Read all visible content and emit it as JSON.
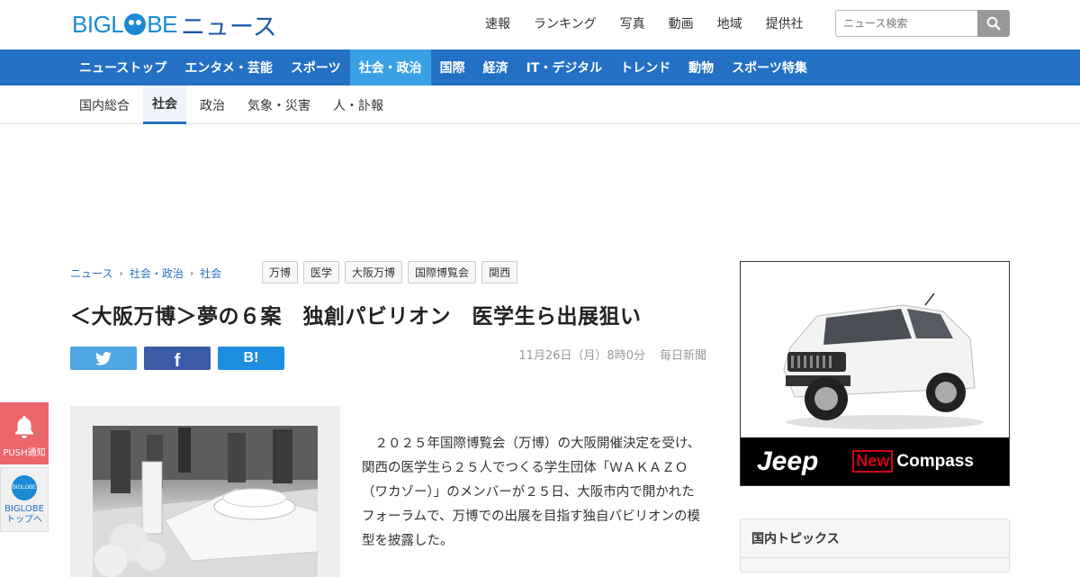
{
  "header": {
    "logo_main": "BIGL",
    "logo_rest": "BE",
    "logo_news": "ニュース",
    "top_links": [
      "速報",
      "ランキング",
      "写真",
      "動画",
      "地域",
      "提供社"
    ],
    "search_placeholder": "ニュース検索"
  },
  "main_nav": [
    {
      "label": "ニューストップ",
      "active": false
    },
    {
      "label": "エンタメ・芸能",
      "active": false
    },
    {
      "label": "スポーツ",
      "active": false
    },
    {
      "label": "社会・政治",
      "active": true
    },
    {
      "label": "国際",
      "active": false
    },
    {
      "label": "経済",
      "active": false
    },
    {
      "label": "IT・デジタル",
      "active": false
    },
    {
      "label": "トレンド",
      "active": false
    },
    {
      "label": "動物",
      "active": false
    },
    {
      "label": "スポーツ特集",
      "active": false
    }
  ],
  "sub_nav": [
    {
      "label": "国内総合",
      "active": false
    },
    {
      "label": "社会",
      "active": true
    },
    {
      "label": "政治",
      "active": false
    },
    {
      "label": "気象・災害",
      "active": false
    },
    {
      "label": "人・訃報",
      "active": false
    }
  ],
  "breadcrumb": [
    "ニュース",
    "社会・政治",
    "社会"
  ],
  "tags": [
    "万博",
    "医学",
    "大阪万博",
    "国際博覧会",
    "関西"
  ],
  "article": {
    "title": "＜大阪万博＞夢の６案　独創パビリオン　医学生ら出展狙い",
    "date": "11月26日（月）8時0分",
    "source": "毎日新聞",
    "body": "　２０２５年国際博覧会（万博）の大阪開催決定を受け、関西の医学生ら２５人でつくる学生団体「ＷＡＫＡＺＯ（ワカゾー）」のメンバーが２５日、大阪市内で開かれたフォーラムで、万博での出展を目指す独自パビリオンの模型を披露した。"
  },
  "share": {
    "twitter": "twitter-icon",
    "facebook": "f",
    "hatena": "B!"
  },
  "ad": {
    "brand": "Jeep",
    "new_label": "New",
    "model": "Compass"
  },
  "sidebar": {
    "topics_title": "国内トピックス"
  },
  "floating": {
    "push_label": "PUSH通知",
    "biglobe_circle": "BIGLOBE",
    "biglobe_label_1": "BIGLOBE",
    "biglobe_label_2": "トップへ"
  },
  "colors": {
    "nav_blue": "#2370c4",
    "active_blue": "#3aa0e4",
    "push_red": "#e9666b"
  }
}
